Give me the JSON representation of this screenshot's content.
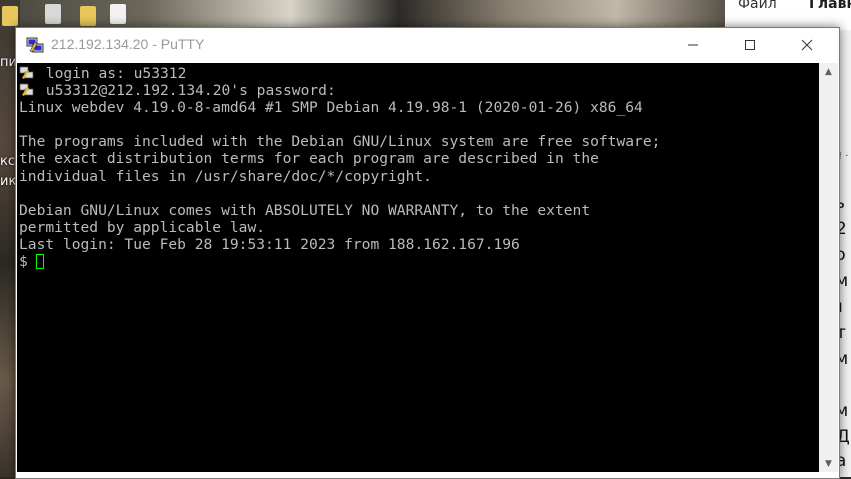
{
  "window": {
    "title": "212.192.134.20 - PuTTY",
    "icon": "putty-icon",
    "controls": {
      "minimize": "minimize-icon",
      "maximize": "maximize-icon",
      "close": "close-icon"
    }
  },
  "terminal": {
    "lines": [
      " login as: u53312",
      " u53312@212.192.134.20's password:",
      "Linux webdev 4.19.0-8-amd64 #1 SMP Debian 4.19.98-1 (2020-01-26) x86_64",
      "",
      "The programs included with the Debian GNU/Linux system are free software;",
      "the exact distribution terms for each program are described in the",
      "individual files in /usr/share/doc/*/copyright.",
      "",
      "Debian GNU/Linux comes with ABSOLUTELY NO WARRANTY, to the extent",
      "permitted by applicable law.",
      "Last login: Tue Feb 28 19:53:11 2023 from 188.162.167.196"
    ],
    "prompt": "$",
    "colors": {
      "background": "#000000",
      "foreground": "#bbbbbb",
      "cursor": "#00ff00"
    }
  },
  "background_app": {
    "tabs": [
      "Файл",
      "Главн"
    ],
    "ruler_text": "! ·",
    "text_fragments": [
      "ть",
      "02",
      "ко",
      "ом",
      "ru",
      "ит",
      "ом",
      "d",
      "ом",
      "- Д",
      "ла"
    ]
  },
  "desktop": {
    "labels": [
      "пи",
      "кс",
      "ик"
    ]
  }
}
